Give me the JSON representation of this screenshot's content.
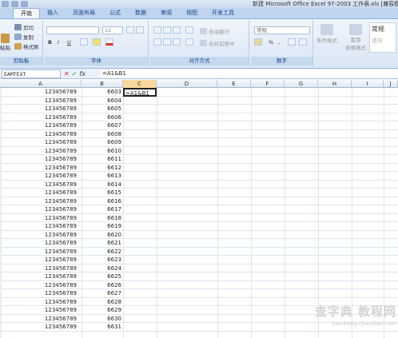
{
  "window": {
    "title": "新建 Microsoft Office Excel 97-2003 工作表.xls [兼容模式",
    "quick_access": [
      "save-icon",
      "undo-icon",
      "redo-icon"
    ]
  },
  "ribbon_tabs": [
    {
      "label": "开始",
      "active": true
    },
    {
      "label": "插入",
      "active": false
    },
    {
      "label": "页面布局",
      "active": false
    },
    {
      "label": "公式",
      "active": false
    },
    {
      "label": "数据",
      "active": false
    },
    {
      "label": "审阅",
      "active": false
    },
    {
      "label": "视图",
      "active": false
    },
    {
      "label": "开发工具",
      "active": false
    }
  ],
  "clipboard": {
    "paste_label": "粘贴",
    "cut_label": "剪切",
    "copy_label": "复制",
    "format_painter_label": "格式刷",
    "group_label": "剪贴板"
  },
  "font": {
    "font_size": "12",
    "bold": "B",
    "italic": "I",
    "underline": "U",
    "group_label": "字体"
  },
  "alignment": {
    "wrap_label": "自动换行",
    "merge_label": "合并后居中",
    "group_label": "对齐方式"
  },
  "number": {
    "format_value": "常规",
    "percent": "%",
    "comma": ",",
    "group_label": "数字"
  },
  "styles": {
    "conditional_label": "条件格式",
    "table_label": "套用",
    "table_label2": "表格格式",
    "style_gallery_label": "常规",
    "style_gallery_label2": "适中"
  },
  "formula_bar": {
    "name_box": "EAMTEXT",
    "cancel": "✕",
    "enter": "✓",
    "fx": "fx",
    "formula": "=A1&B1"
  },
  "columns": [
    "A",
    "B",
    "C",
    "D",
    "E",
    "F",
    "G",
    "H",
    "I",
    "J"
  ],
  "active_cell_text": "=A1&B1",
  "rows": [
    {
      "a": "123456789",
      "b": "6603"
    },
    {
      "a": "123456789",
      "b": "6604"
    },
    {
      "a": "123456789",
      "b": "6605"
    },
    {
      "a": "123456789",
      "b": "6606"
    },
    {
      "a": "123456789",
      "b": "6607"
    },
    {
      "a": "123456789",
      "b": "6608"
    },
    {
      "a": "123456789",
      "b": "6609"
    },
    {
      "a": "123456789",
      "b": "6610"
    },
    {
      "a": "123456789",
      "b": "6611"
    },
    {
      "a": "123456789",
      "b": "6612"
    },
    {
      "a": "123456789",
      "b": "6613"
    },
    {
      "a": "123456789",
      "b": "6614"
    },
    {
      "a": "123456789",
      "b": "6615"
    },
    {
      "a": "123456789",
      "b": "6616"
    },
    {
      "a": "123456789",
      "b": "6617"
    },
    {
      "a": "123456789",
      "b": "6618"
    },
    {
      "a": "123456789",
      "b": "6619"
    },
    {
      "a": "123456789",
      "b": "6620"
    },
    {
      "a": "123456789",
      "b": "6621"
    },
    {
      "a": "123456789",
      "b": "6622"
    },
    {
      "a": "123456789",
      "b": "6623"
    },
    {
      "a": "123456789",
      "b": "6624"
    },
    {
      "a": "123456789",
      "b": "6625"
    },
    {
      "a": "123456789",
      "b": "6626"
    },
    {
      "a": "123456789",
      "b": "6627"
    },
    {
      "a": "123456789",
      "b": "6628"
    },
    {
      "a": "123456789",
      "b": "6629"
    },
    {
      "a": "123456789",
      "b": "6630"
    },
    {
      "a": "123456789",
      "b": "6631"
    }
  ],
  "watermark": {
    "big": "查字典 教程网",
    "small": "jiaocheng.chazidian.com"
  },
  "colors": {
    "ribbon_tab_bg": "#bfd4ee",
    "selected_header": "#f9d99b"
  }
}
